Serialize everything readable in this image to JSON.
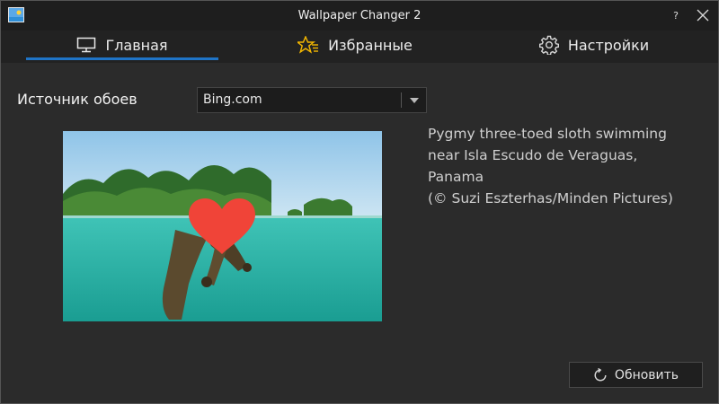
{
  "window": {
    "title": "Wallpaper Changer 2",
    "help_label": "?"
  },
  "tabs": [
    {
      "label": "Главная",
      "icon": "monitor-icon",
      "active": true
    },
    {
      "label": "Избранные",
      "icon": "star-list-icon",
      "active": false
    },
    {
      "label": "Настройки",
      "icon": "gear-icon",
      "active": false
    }
  ],
  "main": {
    "source_label": "Источник обоев",
    "source_select": {
      "value": "Bing.com"
    },
    "wallpaper": {
      "caption": "Pygmy three-toed sloth swimming\nnear Isla Escudo de Veraguas, Panama\n(© Suzi Eszterhas/Minden Pictures)",
      "favorite_icon": "heart-icon"
    },
    "refresh_button": {
      "label": "Обновить",
      "icon": "refresh-icon"
    }
  },
  "colors": {
    "accent": "#1f74c7",
    "heart": "#f04438",
    "star": "#f5b800"
  }
}
